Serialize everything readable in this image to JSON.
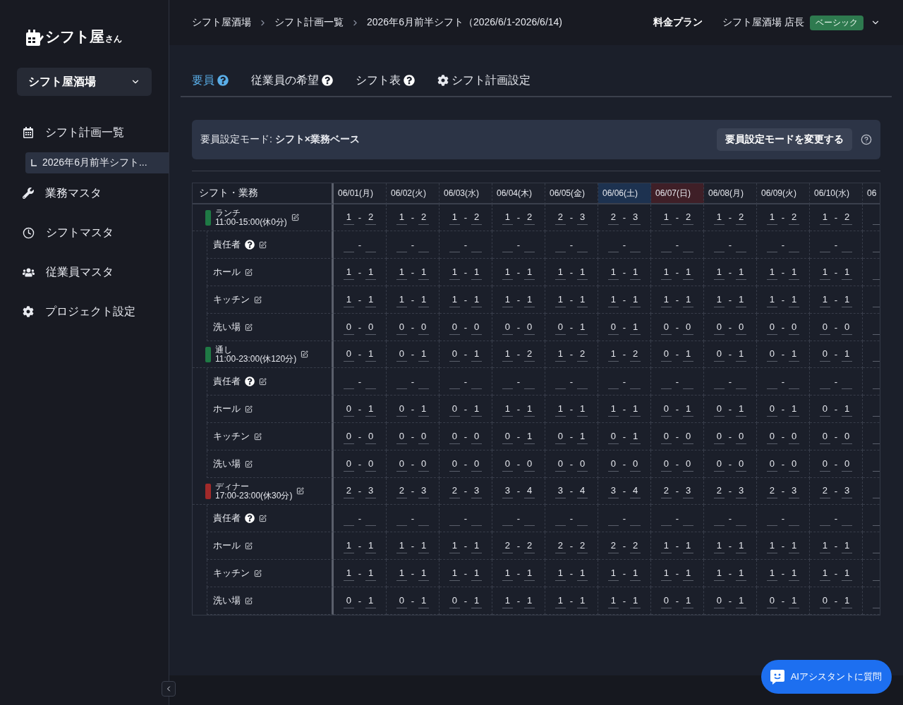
{
  "logo": {
    "name": "シフト屋",
    "suffix": "さん"
  },
  "store_select": {
    "value": "シフト屋酒場"
  },
  "sidebar": {
    "items": [
      {
        "label": "シフト計画一覧",
        "kind": "calendar",
        "children": [
          {
            "label": "2026年6月前半シフト...",
            "selected": true
          }
        ]
      },
      {
        "label": "業務マスタ",
        "kind": "tasks"
      },
      {
        "label": "シフトマスタ",
        "kind": "shifts"
      },
      {
        "label": "従業員マスタ",
        "kind": "staff"
      },
      {
        "label": "プロジェクト設定",
        "kind": "settings"
      }
    ]
  },
  "breadcrumb": [
    "シフト屋酒場",
    "シフト計画一覧",
    "2026年6月前半シフト（2026/6/1-2026/6/14)"
  ],
  "header": {
    "pricing_link": "料金プラン",
    "user": "シフト屋酒場 店長",
    "plan_badge": "ベーシック"
  },
  "tabs": [
    {
      "label": "要員",
      "kind": "help",
      "selected": true
    },
    {
      "label": "従業員の希望",
      "kind": "help",
      "selected": false
    },
    {
      "label": "シフト表",
      "kind": "help",
      "selected": false
    },
    {
      "label": "シフト計画設定",
      "kind": "settings",
      "selected": false
    }
  ],
  "mode_bar": {
    "label": "要員設定モード: ",
    "value": "シフト×業務ベース",
    "button": "要員設定モードを変更する"
  },
  "table": {
    "corner": "シフト・業務",
    "separator": "-",
    "columns": [
      {
        "label": "06/01(月)"
      },
      {
        "label": "06/02(火)"
      },
      {
        "label": "06/03(水)"
      },
      {
        "label": "06/04(木)"
      },
      {
        "label": "06/05(金)"
      },
      {
        "label": "06/06(土)",
        "color": "#1d3250"
      },
      {
        "label": "06/07(日)",
        "color": "#3f1f27"
      },
      {
        "label": "06/08(月)"
      },
      {
        "label": "06/09(火)"
      },
      {
        "label": "06/10(水)"
      },
      {
        "label": "06"
      }
    ],
    "groups": [
      {
        "name": "ランチ",
        "time": "11:00-15:00(休0分)",
        "color": "#1f7a45",
        "cells": [
          [
            "1",
            "2"
          ],
          [
            "1",
            "2"
          ],
          [
            "1",
            "2"
          ],
          [
            "1",
            "2"
          ],
          [
            "2",
            "3"
          ],
          [
            "2",
            "3"
          ],
          [
            "1",
            "2"
          ],
          [
            "1",
            "2"
          ],
          [
            "1",
            "2"
          ],
          [
            "1",
            "2"
          ]
        ],
        "tasks": [
          {
            "name": "責任者",
            "help": true
          },
          {
            "name": "ホール",
            "help": false,
            "cells": [
              [
                "1",
                "1"
              ],
              [
                "1",
                "1"
              ],
              [
                "1",
                "1"
              ],
              [
                "1",
                "1"
              ],
              [
                "1",
                "1"
              ],
              [
                "1",
                "1"
              ],
              [
                "1",
                "1"
              ],
              [
                "1",
                "1"
              ],
              [
                "1",
                "1"
              ],
              [
                "1",
                "1"
              ]
            ]
          },
          {
            "name": "キッチン",
            "help": false,
            "cells": [
              [
                "1",
                "1"
              ],
              [
                "1",
                "1"
              ],
              [
                "1",
                "1"
              ],
              [
                "1",
                "1"
              ],
              [
                "1",
                "1"
              ],
              [
                "1",
                "1"
              ],
              [
                "1",
                "1"
              ],
              [
                "1",
                "1"
              ],
              [
                "1",
                "1"
              ],
              [
                "1",
                "1"
              ]
            ]
          },
          {
            "name": "洗い場",
            "help": false,
            "cells": [
              [
                "0",
                "0"
              ],
              [
                "0",
                "0"
              ],
              [
                "0",
                "0"
              ],
              [
                "0",
                "0"
              ],
              [
                "0",
                "1"
              ],
              [
                "0",
                "1"
              ],
              [
                "0",
                "0"
              ],
              [
                "0",
                "0"
              ],
              [
                "0",
                "0"
              ],
              [
                "0",
                "0"
              ]
            ]
          }
        ]
      },
      {
        "name": "通し",
        "time": "11:00-23:00(休120分)",
        "color": "#1f7a45",
        "cells": [
          [
            "0",
            "1"
          ],
          [
            "0",
            "1"
          ],
          [
            "0",
            "1"
          ],
          [
            "1",
            "2"
          ],
          [
            "1",
            "2"
          ],
          [
            "1",
            "2"
          ],
          [
            "0",
            "1"
          ],
          [
            "0",
            "1"
          ],
          [
            "0",
            "1"
          ],
          [
            "0",
            "1"
          ]
        ],
        "tasks": [
          {
            "name": "責任者",
            "help": true
          },
          {
            "name": "ホール",
            "help": false,
            "cells": [
              [
                "0",
                "1"
              ],
              [
                "0",
                "1"
              ],
              [
                "0",
                "1"
              ],
              [
                "1",
                "1"
              ],
              [
                "1",
                "1"
              ],
              [
                "1",
                "1"
              ],
              [
                "0",
                "1"
              ],
              [
                "0",
                "1"
              ],
              [
                "0",
                "1"
              ],
              [
                "0",
                "1"
              ]
            ]
          },
          {
            "name": "キッチン",
            "help": false,
            "cells": [
              [
                "0",
                "0"
              ],
              [
                "0",
                "0"
              ],
              [
                "0",
                "0"
              ],
              [
                "0",
                "1"
              ],
              [
                "0",
                "1"
              ],
              [
                "0",
                "1"
              ],
              [
                "0",
                "0"
              ],
              [
                "0",
                "0"
              ],
              [
                "0",
                "0"
              ],
              [
                "0",
                "0"
              ]
            ]
          },
          {
            "name": "洗い場",
            "help": false,
            "cells": [
              [
                "0",
                "0"
              ],
              [
                "0",
                "0"
              ],
              [
                "0",
                "0"
              ],
              [
                "0",
                "0"
              ],
              [
                "0",
                "0"
              ],
              [
                "0",
                "0"
              ],
              [
                "0",
                "0"
              ],
              [
                "0",
                "0"
              ],
              [
                "0",
                "0"
              ],
              [
                "0",
                "0"
              ]
            ]
          }
        ]
      },
      {
        "name": "ディナー",
        "time": "17:00-23:00(休30分)",
        "color": "#a12a2a",
        "cells": [
          [
            "2",
            "3"
          ],
          [
            "2",
            "3"
          ],
          [
            "2",
            "3"
          ],
          [
            "3",
            "4"
          ],
          [
            "3",
            "4"
          ],
          [
            "3",
            "4"
          ],
          [
            "2",
            "3"
          ],
          [
            "2",
            "3"
          ],
          [
            "2",
            "3"
          ],
          [
            "2",
            "3"
          ]
        ],
        "tasks": [
          {
            "name": "責任者",
            "help": true
          },
          {
            "name": "ホール",
            "help": false,
            "cells": [
              [
                "1",
                "1"
              ],
              [
                "1",
                "1"
              ],
              [
                "1",
                "1"
              ],
              [
                "2",
                "2"
              ],
              [
                "2",
                "2"
              ],
              [
                "2",
                "2"
              ],
              [
                "1",
                "1"
              ],
              [
                "1",
                "1"
              ],
              [
                "1",
                "1"
              ],
              [
                "1",
                "1"
              ]
            ]
          },
          {
            "name": "キッチン",
            "help": false,
            "cells": [
              [
                "1",
                "1"
              ],
              [
                "1",
                "1"
              ],
              [
                "1",
                "1"
              ],
              [
                "1",
                "1"
              ],
              [
                "1",
                "1"
              ],
              [
                "1",
                "1"
              ],
              [
                "1",
                "1"
              ],
              [
                "1",
                "1"
              ],
              [
                "1",
                "1"
              ],
              [
                "1",
                "1"
              ]
            ]
          },
          {
            "name": "洗い場",
            "help": false,
            "cells": [
              [
                "0",
                "1"
              ],
              [
                "0",
                "1"
              ],
              [
                "0",
                "1"
              ],
              [
                "1",
                "1"
              ],
              [
                "1",
                "1"
              ],
              [
                "1",
                "1"
              ],
              [
                "0",
                "1"
              ],
              [
                "0",
                "1"
              ],
              [
                "0",
                "1"
              ],
              [
                "0",
                "1"
              ]
            ]
          }
        ]
      }
    ]
  },
  "ai_button": {
    "label": "AIアシスタントに質問"
  }
}
